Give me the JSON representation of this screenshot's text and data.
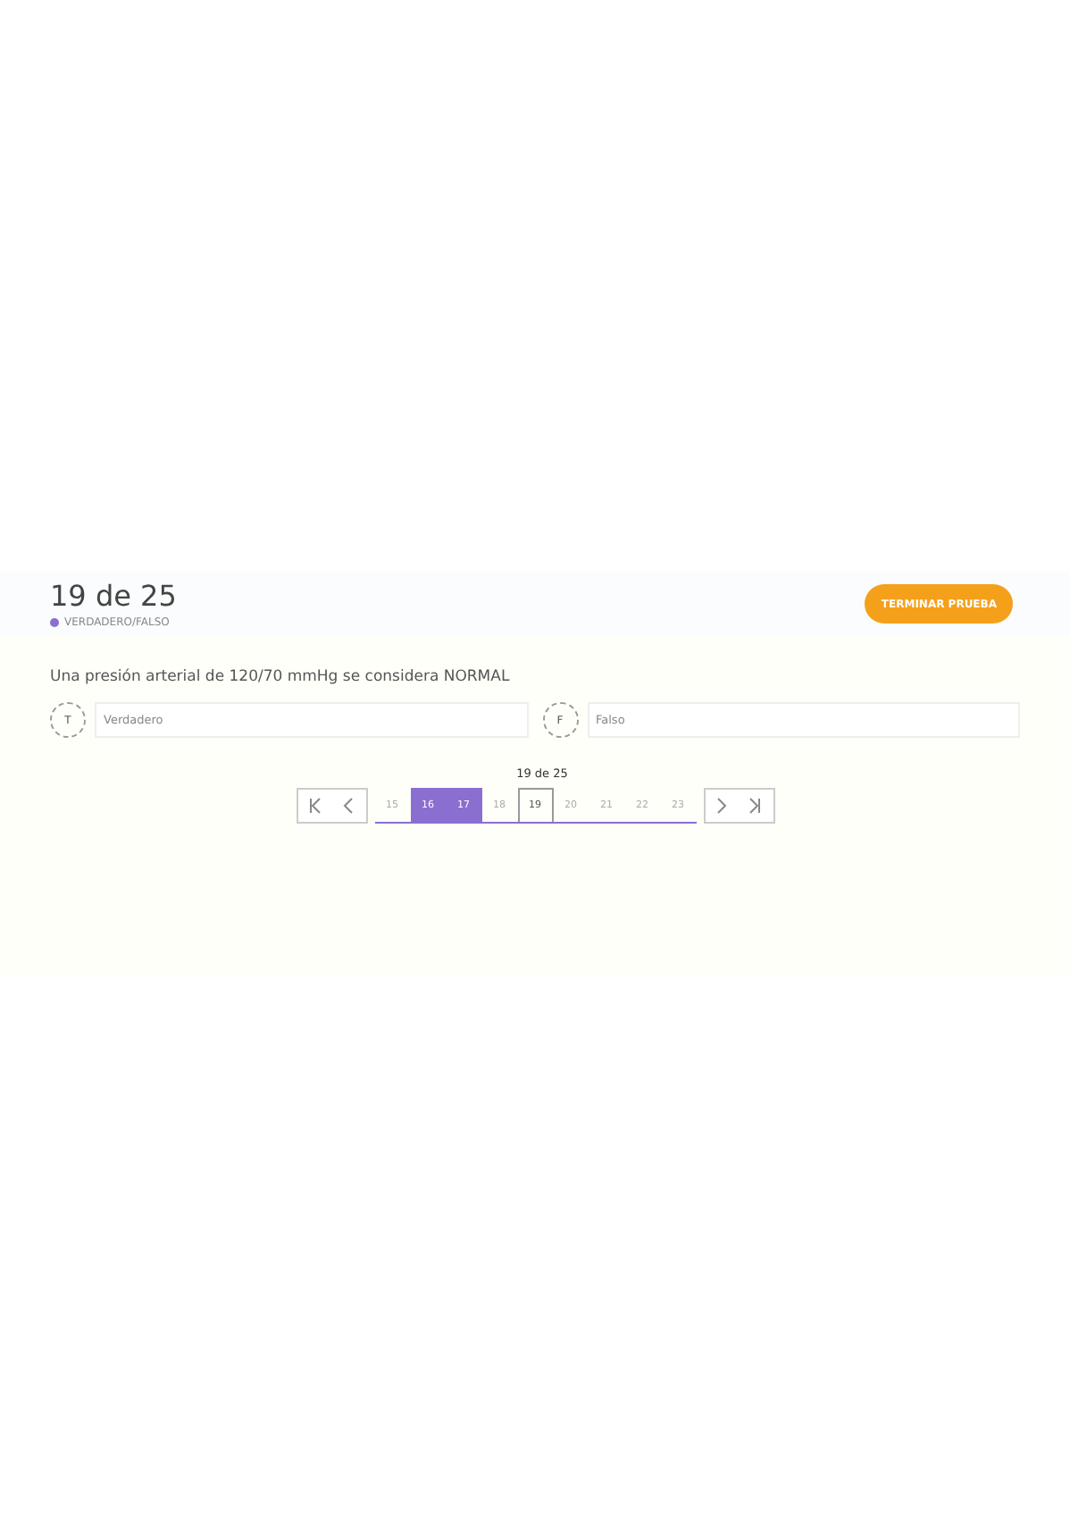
{
  "header": {
    "counter": "19 de 25",
    "question_type": "VERDADERO/FALSO",
    "finish_button": "TERMINAR PRUEBA"
  },
  "question": {
    "text": "Una presión arterial de 120/70 mmHg se considera NORMAL"
  },
  "options": [
    {
      "letter": "T",
      "label": "Verdadero",
      "selected": false
    },
    {
      "letter": "F",
      "label": "Falso",
      "selected": false
    }
  ],
  "pager": {
    "tooltip": "19 de 25",
    "pages": [
      {
        "label": "15",
        "answered": false,
        "selected": false
      },
      {
        "label": "16",
        "answered": true,
        "selected": false
      },
      {
        "label": "17",
        "answered": true,
        "selected": false
      },
      {
        "label": "18",
        "answered": false,
        "selected": false
      },
      {
        "label": "19",
        "answered": false,
        "selected": true
      },
      {
        "label": "20",
        "answered": false,
        "selected": false
      },
      {
        "label": "21",
        "answered": false,
        "selected": false
      },
      {
        "label": "22",
        "answered": false,
        "selected": false
      },
      {
        "label": "23",
        "answered": false,
        "selected": false
      }
    ]
  }
}
